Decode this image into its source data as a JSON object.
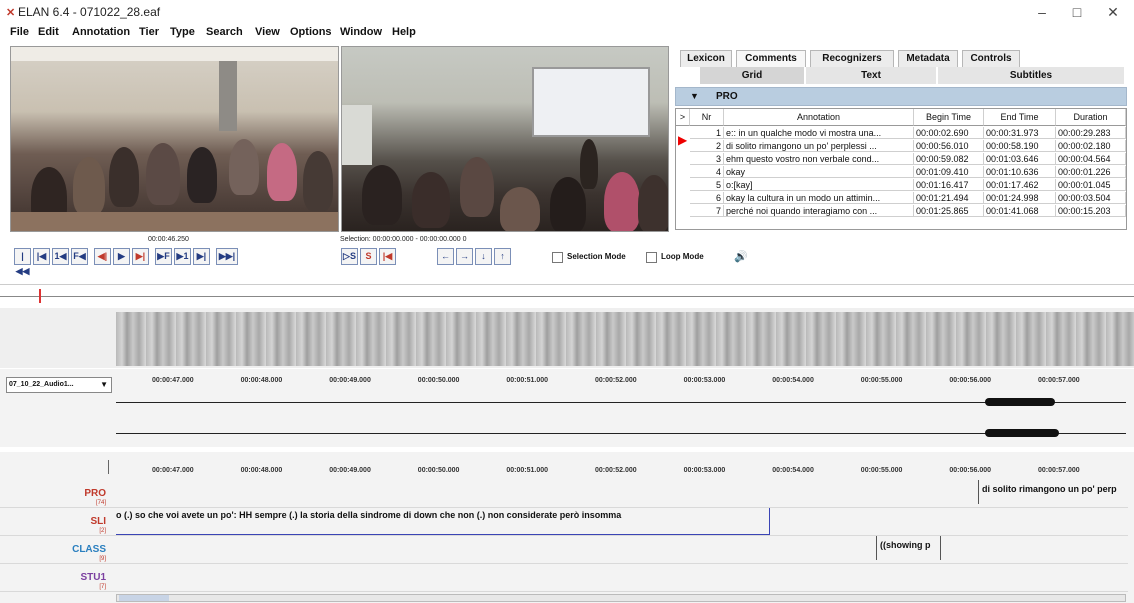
{
  "window": {
    "title": "ELAN 6.4 - 071022_28.eaf",
    "icon": "elan-icon"
  },
  "window_controls": {
    "minimize": "–",
    "maximize": "□",
    "close": "✕"
  },
  "menu": [
    "File",
    "Edit",
    "Annotation",
    "Tier",
    "Type",
    "Search",
    "View",
    "Options",
    "Window",
    "Help"
  ],
  "media": {
    "timecode": "00:00:46.250",
    "selection": "Selection: 00:00:00.000 - 00:00:00.000  0"
  },
  "controls": {
    "buttons": [
      "|◀◀",
      "|◀",
      "1◀",
      "F◀",
      "◀|",
      "▶",
      "▶|",
      "▶F",
      "▶1",
      "▶|",
      "▶▶|"
    ],
    "selection_buttons": [
      "▷S",
      "S",
      "|◀"
    ],
    "nav_buttons": [
      "←",
      "→",
      "↓",
      "↑"
    ],
    "selection_mode": "Selection Mode",
    "loop_mode": "Loop Mode",
    "volume": "🔊"
  },
  "tabs": [
    "Lexicon",
    "Comments",
    "Recognizers",
    "Metadata",
    "Controls"
  ],
  "subtabs": [
    "Grid",
    "Text",
    "Subtitles"
  ],
  "grid": {
    "tier": "PRO",
    "headers": {
      "nr": "Nr",
      "annotation": "Annotation",
      "begin": "Begin Time",
      "end": "End Time",
      "duration": "Duration"
    },
    "rows": [
      {
        "nr": "1",
        "annotation": "e:: in un qualche modo vi mostra una...",
        "begin": "00:00:02.690",
        "end": "00:00:31.973",
        "duration": "00:00:29.283"
      },
      {
        "nr": "2",
        "annotation": "di solito rimangono un po' perplessi ...",
        "begin": "00:00:56.010",
        "end": "00:00:58.190",
        "duration": "00:00:02.180"
      },
      {
        "nr": "3",
        "annotation": "ehm questo vostro non verbale cond...",
        "begin": "00:00:59.082",
        "end": "00:01:03.646",
        "duration": "00:00:04.564"
      },
      {
        "nr": "4",
        "annotation": "okay",
        "begin": "00:01:09.410",
        "end": "00:01:10.636",
        "duration": "00:00:01.226"
      },
      {
        "nr": "5",
        "annotation": "o:[kay]",
        "begin": "00:01:16.417",
        "end": "00:01:17.462",
        "duration": "00:00:01.045"
      },
      {
        "nr": "6",
        "annotation": "okay la cultura in un modo un attimin...",
        "begin": "00:01:21.494",
        "end": "00:01:24.998",
        "duration": "00:00:03.504"
      },
      {
        "nr": "7",
        "annotation": "perché noi quando interagiamo con ...",
        "begin": "00:01:25.865",
        "end": "00:01:41.068",
        "duration": "00:00:15.203"
      }
    ]
  },
  "timeline": {
    "ticks": [
      "00:00:47.000",
      "00:00:48.000",
      "00:00:49.000",
      "00:00:50.000",
      "00:00:51.000",
      "00:00:52.000",
      "00:00:53.000",
      "00:00:54.000",
      "00:00:55.000",
      "00:00:56.000",
      "00:00:57.000"
    ],
    "audio_track": "07_10_22_Audio1..."
  },
  "tiers": [
    {
      "name": "PRO",
      "count": "[74]",
      "color": "#c0392b",
      "annotation": "di solito rimangono un po' perp"
    },
    {
      "name": "SLI",
      "count": "[2]",
      "color": "#c0392b",
      "annotation": "o (.) so che voi avete un po': HH sempre (.) la storia della sindrome di down che non (.) non considerate però insomma"
    },
    {
      "name": "CLASS",
      "count": "[9]",
      "color": "#2a7fbf",
      "annotation": "((showing p"
    },
    {
      "name": "STU1",
      "count": "[7]",
      "color": "#7b3fa0",
      "annotation": ""
    }
  ]
}
